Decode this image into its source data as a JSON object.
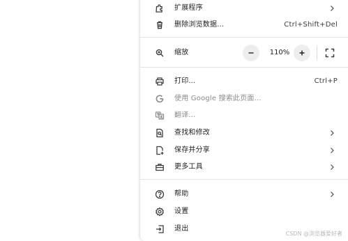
{
  "menu": {
    "extensions": {
      "label": "扩展程序",
      "icon": "puzzle-icon"
    },
    "clear_data": {
      "label": "删除浏览数据...",
      "shortcut": "Ctrl+Shift+Del",
      "icon": "trash-icon"
    },
    "zoom": {
      "label": "缩放",
      "value": "110%",
      "minus": "−",
      "plus": "+",
      "icon": "zoom-icon"
    },
    "print": {
      "label": "打印...",
      "shortcut": "Ctrl+P",
      "icon": "printer-icon"
    },
    "google_search": {
      "label": "使用 Google 搜索此页面...",
      "icon": "google-g-icon"
    },
    "translate": {
      "label": "翻译...",
      "icon": "translate-icon"
    },
    "find_edit": {
      "label": "查找和修改",
      "icon": "find-page-icon"
    },
    "save_share": {
      "label": "保存并分享",
      "icon": "save-share-icon"
    },
    "more_tools": {
      "label": "更多工具",
      "icon": "toolbox-icon"
    },
    "help": {
      "label": "帮助",
      "icon": "help-icon"
    },
    "settings": {
      "label": "设置",
      "icon": "gear-icon"
    },
    "exit": {
      "label": "退出",
      "icon": "exit-icon"
    }
  },
  "watermark": "CSDN @浏览器爱好者",
  "colors": {
    "text": "#1f1f1f",
    "separator": "#e3e3e3",
    "zoom_button_bg": "#eeeeee",
    "dim_text": "#8a8a8a"
  }
}
